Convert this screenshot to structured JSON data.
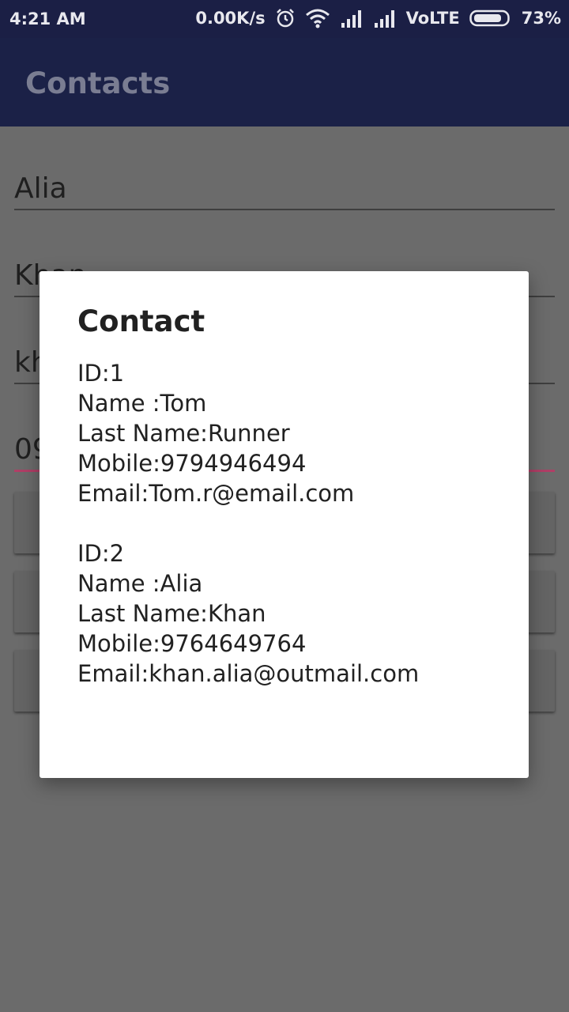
{
  "status_bar": {
    "time": "4:21 AM",
    "network_speed": "0.00K/s",
    "network_type": "VoLTE",
    "battery": "73%"
  },
  "app_bar": {
    "title": "Contacts"
  },
  "form": {
    "first_name": "Alia",
    "last_name": "Khan",
    "email_partial": "kh",
    "mobile_partial": "09"
  },
  "dialog": {
    "title": "Contact",
    "contacts": [
      {
        "id": "ID:1",
        "name": "Name :Tom",
        "last_name": "Last Name:Runner",
        "mobile": "Mobile:9794946494",
        "email": "Email:Tom.r@email.com"
      },
      {
        "id": "ID:2",
        "name": "Name :Alia",
        "last_name": "Last Name:Khan",
        "mobile": "Mobile:9764649764",
        "email": "Email:khan.alia@outmail.com"
      }
    ]
  }
}
